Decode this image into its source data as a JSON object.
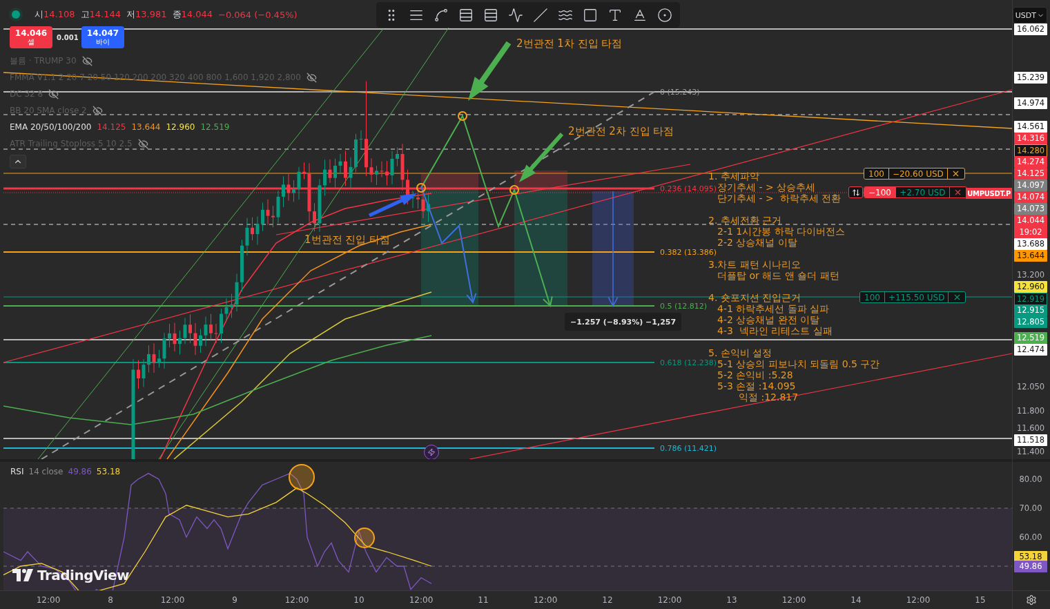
{
  "legend": {
    "ohlc": [
      {
        "label": "시",
        "value": "14.108"
      },
      {
        "label": "고",
        "value": "14.144"
      },
      {
        "label": "저",
        "value": "13.981"
      },
      {
        "label": "종",
        "value": "14.044"
      }
    ],
    "change": "−0.064 (−0.45%)",
    "trade": {
      "sell": {
        "price": "14.046",
        "label": "셀"
      },
      "spread": "0.001",
      "buy": {
        "price": "14.047",
        "label": "바이"
      }
    },
    "indicators": [
      {
        "name": "볼륨 · TRUMP 30",
        "hidden": true
      },
      {
        "name": "FMMA V1.1 2 20 7 20 50 120 200 200 320 400 800 1,600 1,920 2,800",
        "hidden": true
      },
      {
        "name": "DC 32 8",
        "hidden": true
      },
      {
        "name": "BB 20 SMA close 2",
        "hidden": true
      },
      {
        "name": "EMA 20/50/100/200",
        "hidden": false,
        "values": [
          {
            "text": "14.125",
            "color": "#f23645"
          },
          {
            "text": "13.644",
            "color": "#f7931a"
          },
          {
            "text": "12.960",
            "color": "#f5e33b"
          },
          {
            "text": "12.519",
            "color": "#4caf50"
          }
        ]
      },
      {
        "name": "ATR Trailing Stoploss 5 10 2.5",
        "hidden": true
      }
    ]
  },
  "currency": "USDT",
  "annotations": [
    {
      "text": "2번관전 1차 진입 타점"
    },
    {
      "text": "2번관전 2차 진입 타점"
    },
    {
      "text": "1번관전 진입 타점"
    }
  ],
  "fib_levels": [
    {
      "label": "0 (15.243)",
      "color": "#9e9e9e"
    },
    {
      "label": "0.236 (14.095)",
      "color": "#f23645"
    },
    {
      "label": "0.382 (13.386)",
      "color": "#f7a21b"
    },
    {
      "label": "0.5 (12.812)",
      "color": "#4caf50"
    },
    {
      "label": "0.618 (12.238)",
      "color": "#089981"
    },
    {
      "label": "0.786 (11.421)",
      "color": "#22b8d4"
    }
  ],
  "note": [
    {
      "heading": "1. 추세파악",
      "items": [
        {
          "text": "장기추세 - > 상승추세",
          "kind": "line"
        },
        {
          "text": "단기추세 - >  하락추세 전환",
          "kind": "line"
        }
      ]
    },
    {
      "heading": "2. 추세전환 근거",
      "items": [
        {
          "text": "2-1 1시간봉 하락 다이버전스",
          "kind": "line"
        },
        {
          "text": "2-2 상승채널 이탈",
          "kind": "line"
        }
      ]
    },
    {
      "heading": "3.차트 패턴 시나리오",
      "items": [
        {
          "text": "더플탑 or 해드 앤 숄더 패턴",
          "kind": "line"
        }
      ]
    },
    {
      "heading": "4. 숏포지션 진입근거",
      "items": [
        {
          "text": "4-1 하락추세선 돌파 실파",
          "kind": "line"
        },
        {
          "text": "4-2 상승채널 완전 이탈",
          "kind": "line"
        },
        {
          "text": "4-3  넥라인 리테스트 실패",
          "kind": "line"
        }
      ]
    },
    {
      "heading": "5. 손익비 설정",
      "items": [
        {
          "text": "5-1 상승의 피보나치 되돌림 0.5 구간",
          "kind": "line"
        },
        {
          "text": "5-2 손익비 :5.28",
          "kind": "line"
        },
        {
          "text": "5-3 손절 :14.095",
          "kind": "line"
        },
        {
          "text": "익절 :12.817",
          "kind": "continuation"
        }
      ]
    }
  ],
  "orders": [
    {
      "kind": "order",
      "qty": "100",
      "pnl": "−20.60 USD"
    },
    {
      "kind": "position",
      "qty": "−100",
      "pnl": "+2.70 USD"
    },
    {
      "kind": "take_profit",
      "qty": "100",
      "pnl": "+115.50 USD"
    }
  ],
  "symbol_tag": "UMPUSDT.P",
  "measure": "−1.257 (−8.93%) −1,257",
  "price_axis": [
    {
      "text": "16.062",
      "kind": "badge",
      "color": "#ffffff"
    },
    {
      "text": "15.239",
      "kind": "badge",
      "color": "#ffffff"
    },
    {
      "text": "14.974",
      "kind": "badge",
      "color": "#ffffff"
    },
    {
      "text": "14.561",
      "kind": "badge",
      "color": "#ffffff"
    },
    {
      "text": "14.316",
      "kind": "badge",
      "color": "#f23645"
    },
    {
      "text": "14.280",
      "kind": "outline",
      "color": "#f7a21b"
    },
    {
      "text": "14.274",
      "kind": "badge",
      "color": "#f23645"
    },
    {
      "text": "14.125",
      "kind": "badge",
      "color": "#f23645"
    },
    {
      "text": "14.097",
      "kind": "badge",
      "color": "#808080"
    },
    {
      "text": "14.074",
      "kind": "badge",
      "color": "#f23645"
    },
    {
      "text": "14.073",
      "kind": "badge",
      "color": "#808080"
    },
    {
      "text": "14.044",
      "kind": "badge",
      "color": "#f23645",
      "subtext": "19:02"
    },
    {
      "text": "13.688",
      "kind": "badge",
      "color": "#ffffff"
    },
    {
      "text": "13.644",
      "kind": "badge",
      "color": "#ff9800"
    },
    {
      "text": "13.200",
      "kind": "tick"
    },
    {
      "text": "12.960",
      "kind": "badge",
      "color": "#f5e33b"
    },
    {
      "text": "12.919",
      "kind": "outline",
      "color": "#089981"
    },
    {
      "text": "12.915",
      "kind": "badge",
      "color": "#089981"
    },
    {
      "text": "12.805",
      "kind": "badge",
      "color": "#089981"
    },
    {
      "text": "12.519",
      "kind": "badge",
      "color": "#4caf50"
    },
    {
      "text": "12.474",
      "kind": "badge",
      "color": "#ffffff"
    },
    {
      "text": "12.050",
      "kind": "tick"
    },
    {
      "text": "11.800",
      "kind": "tick"
    },
    {
      "text": "11.600",
      "kind": "tick"
    },
    {
      "text": "11.518",
      "kind": "badge",
      "color": "#ffffff"
    },
    {
      "text": "11.400",
      "kind": "tick"
    }
  ],
  "rsi": {
    "name": "RSI",
    "params": "14 close",
    "values": [
      {
        "text": "49.86",
        "color": "#7e57c2"
      },
      {
        "text": "53.18",
        "color": "#f5d33b"
      }
    ],
    "axis": [
      {
        "text": "80.00",
        "kind": "tick"
      },
      {
        "text": "70.00",
        "kind": "tick"
      },
      {
        "text": "60.00",
        "kind": "tick"
      },
      {
        "text": "53.18",
        "kind": "badge",
        "color": "#f5d33b"
      },
      {
        "text": "49.86",
        "kind": "badge",
        "color": "#7e57c2"
      }
    ]
  },
  "logo_text": "TradingView",
  "time_axis": [
    "12:00",
    "8",
    "12:00",
    "9",
    "12:00",
    "10",
    "12:00",
    "11",
    "12:00",
    "12",
    "12:00",
    "13",
    "12:00",
    "14",
    "12:00",
    "15"
  ]
}
